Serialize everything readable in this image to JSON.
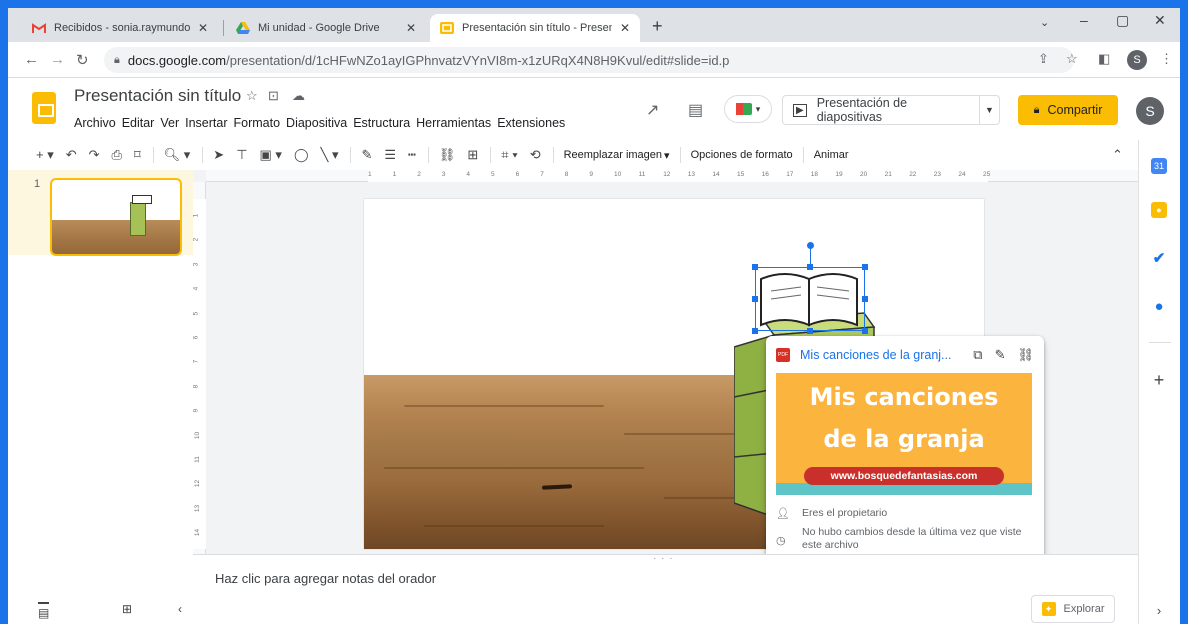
{
  "browser": {
    "tabs": [
      {
        "title": "Recibidos - sonia.raymundo.arr@",
        "icon": "gmail-icon",
        "active": false
      },
      {
        "title": "Mi unidad - Google Drive",
        "icon": "drive-icon",
        "active": false
      },
      {
        "title": "Presentación sin título - Presenta",
        "icon": "slides-icon",
        "active": true
      }
    ],
    "url_host": "docs.google.com",
    "url_path": "/presentation/d/1cHFwNZo1ayIGPhnvatzVYnVI8m-x1zURqX4N8H9Kvul/edit#slide=id.p",
    "profile_initial": "S"
  },
  "app": {
    "doc_title": "Presentación sin título",
    "menu": [
      "Archivo",
      "Editar",
      "Ver",
      "Insertar",
      "Formato",
      "Diapositiva",
      "Estructura",
      "Herramientas",
      "Extensiones"
    ],
    "present_label": "Presentación de diapositivas",
    "share_label": "Compartir",
    "avatar_initial": "S",
    "accent": "#fbbc04"
  },
  "toolbar": {
    "replace_image": "Reemplazar imagen",
    "format_options": "Opciones de formato",
    "animate": "Animar"
  },
  "filmstrip": {
    "slide_number": "1"
  },
  "ruler": {
    "top_ticks": [
      "1",
      "1",
      "2",
      "3",
      "4",
      "5",
      "6",
      "7",
      "8",
      "9",
      "10",
      "11",
      "12",
      "13",
      "14",
      "15",
      "16",
      "17",
      "18",
      "19",
      "20",
      "21",
      "22",
      "23",
      "24",
      "25"
    ],
    "left_ticks": [
      "1",
      "2",
      "3",
      "4",
      "5",
      "6",
      "7",
      "8",
      "9",
      "10",
      "11",
      "12",
      "13",
      "14"
    ]
  },
  "link_card": {
    "title": "Mis canciones de la granj...",
    "image_line1": "Mis canciones",
    "image_line2": "de la granja",
    "image_url": "www.bosquedefantasias.com",
    "owner_text": "Eres el propietario",
    "changes_text": "No hubo cambios desde la última vez que viste este archivo"
  },
  "notes": {
    "placeholder": "Haz clic para agregar notas del orador",
    "explore_label": "Explorar"
  },
  "sidepanel": {
    "calendar_day": "31"
  }
}
